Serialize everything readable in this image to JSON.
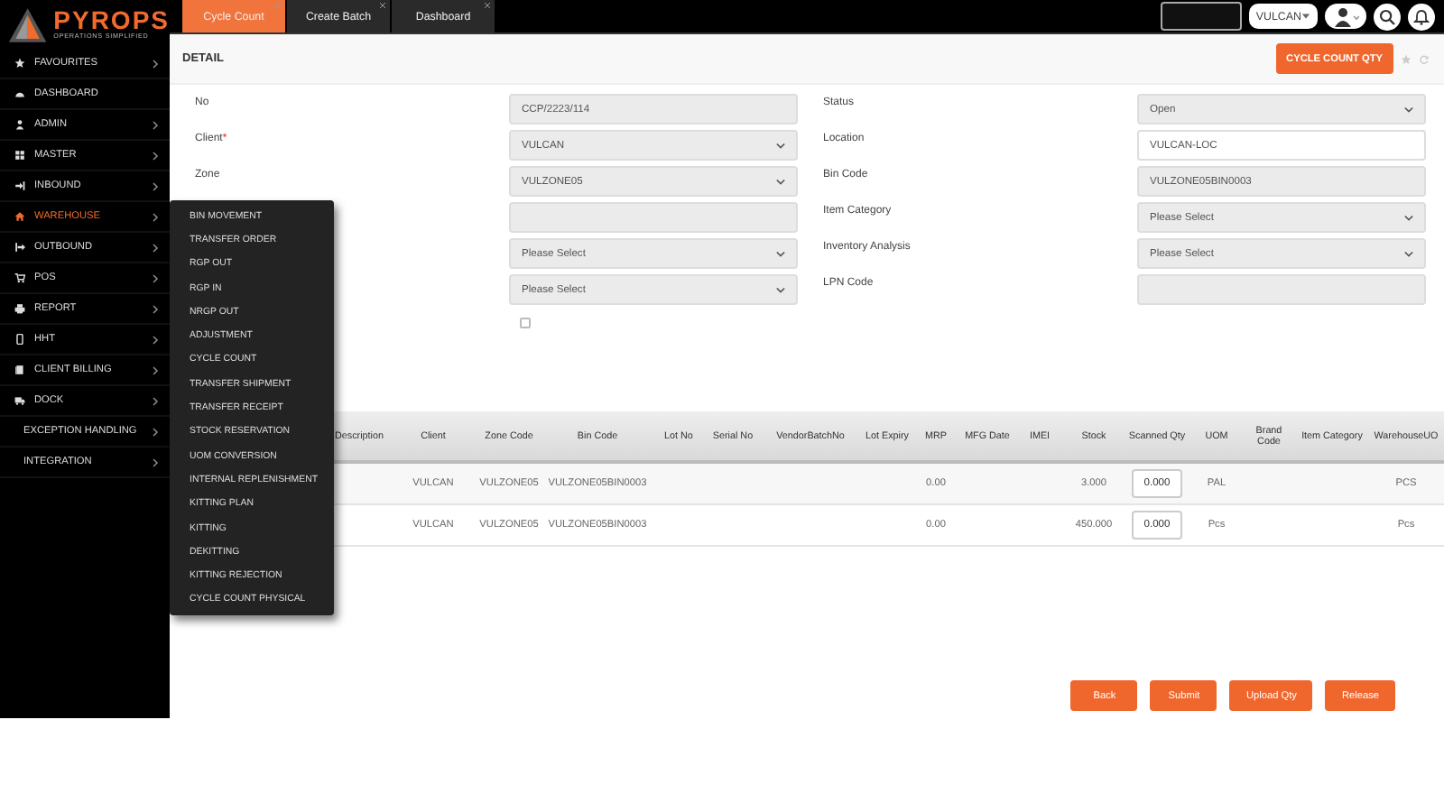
{
  "logo": {
    "name": "PYROPS",
    "tagline": "OPERATIONS SIMPLIFIED"
  },
  "sidebar": {
    "items": [
      {
        "label": "FAVOURITES",
        "has_submenu": true,
        "selected": false
      },
      {
        "label": "DASHBOARD",
        "has_submenu": false,
        "selected": false
      },
      {
        "label": "ADMIN",
        "has_submenu": true,
        "selected": false
      },
      {
        "label": "MASTER",
        "has_submenu": true,
        "selected": false
      },
      {
        "label": "INBOUND",
        "has_submenu": true,
        "selected": false
      },
      {
        "label": "WAREHOUSE",
        "has_submenu": true,
        "selected": true
      },
      {
        "label": "OUTBOUND",
        "has_submenu": true,
        "selected": false
      },
      {
        "label": "POS",
        "has_submenu": true,
        "selected": false
      },
      {
        "label": "REPORT",
        "has_submenu": true,
        "selected": false
      },
      {
        "label": "HHT",
        "has_submenu": true,
        "selected": false
      },
      {
        "label": "CLIENT BILLING",
        "has_submenu": true,
        "selected": false
      },
      {
        "label": "DOCK",
        "has_submenu": true,
        "selected": false
      },
      {
        "label": "EXCEPTION HANDLING",
        "has_submenu": true,
        "selected": false
      },
      {
        "label": "INTEGRATION",
        "has_submenu": true,
        "selected": false
      }
    ]
  },
  "submenu": [
    "BIN MOVEMENT",
    "TRANSFER ORDER",
    "RGP OUT",
    "RGP IN",
    "NRGP OUT",
    "ADJUSTMENT",
    "CYCLE COUNT",
    "TRANSFER SHIPMENT",
    "TRANSFER RECEIPT",
    "STOCK RESERVATION",
    "UOM CONVERSION",
    "INTERNAL REPLENISHMENT",
    "KITTING PLAN",
    "KITTING",
    "DEKITTING",
    "KITTING REJECTION",
    "CYCLE COUNT PHYSICAL"
  ],
  "tabs": [
    {
      "label": "Cycle Count",
      "selected": true
    },
    {
      "label": "Create Batch",
      "selected": false
    },
    {
      "label": "Dashboard",
      "selected": false
    }
  ],
  "topbar": {
    "client_menu": "VULCAN"
  },
  "header": {
    "title": "DETAIL",
    "action": "CYCLE COUNT QTY"
  },
  "form": {
    "left": [
      {
        "label": "No",
        "kind": "text",
        "value": "CCP/2223/114"
      },
      {
        "label": "Client",
        "required_mark": "*",
        "kind": "select",
        "value": "VULCAN"
      },
      {
        "label": "Zone",
        "kind": "select",
        "value": "VULZONE05"
      },
      {
        "kind": "text"
      },
      {
        "kind": "select",
        "value": "Please Select"
      },
      {
        "kind": "select",
        "value": "Please Select"
      },
      {
        "kind": "checkbox",
        "checked": false
      }
    ],
    "right": [
      {
        "label": "Status",
        "kind": "select",
        "value": "Open"
      },
      {
        "label": "Location",
        "kind": "input",
        "value": "VULCAN-LOC"
      },
      {
        "label": "Bin Code",
        "kind": "text",
        "value": "VULZONE05BIN0003"
      },
      {
        "label": "Item Category",
        "kind": "select",
        "value": "Please Select"
      },
      {
        "label": "Inventory Analysis",
        "kind": "select",
        "value": "Please Select"
      },
      {
        "label": "LPN Code",
        "kind": "text"
      }
    ]
  },
  "table": {
    "columns": [
      {
        "label": "Description"
      },
      {
        "label": "Client"
      },
      {
        "label": "Zone Code"
      },
      {
        "label": "Bin Code"
      },
      {
        "label": "Lot No"
      },
      {
        "label": "Serial No"
      },
      {
        "label": "VendorBatchNo"
      },
      {
        "label": "Lot Expiry"
      },
      {
        "label": "MRP"
      },
      {
        "label": "MFG Date"
      },
      {
        "label": "IMEI"
      },
      {
        "label": "Stock"
      },
      {
        "label": "Scanned Qty",
        "kind": "input"
      },
      {
        "label": "UOM"
      },
      {
        "label": "Brand Code"
      },
      {
        "label": "Item Category"
      },
      {
        "label": "WarehouseUO"
      }
    ],
    "rows": [
      {
        "cells": [
          null,
          "VULCAN",
          "VULZONE05",
          "VULZONE05BIN0003",
          null,
          null,
          null,
          null,
          "0.00",
          null,
          null,
          "3.000",
          "0.000",
          "PAL",
          null,
          null,
          "PCS"
        ]
      },
      {
        "cells": [
          null,
          "VULCAN",
          "VULZONE05",
          "VULZONE05BIN0003",
          null,
          null,
          null,
          null,
          "0.00",
          null,
          null,
          "450.000",
          "0.000",
          "Pcs",
          null,
          null,
          "Pcs"
        ]
      }
    ]
  },
  "buttons": [
    "Back",
    "Submit",
    "Upload Qty",
    "Release"
  ]
}
